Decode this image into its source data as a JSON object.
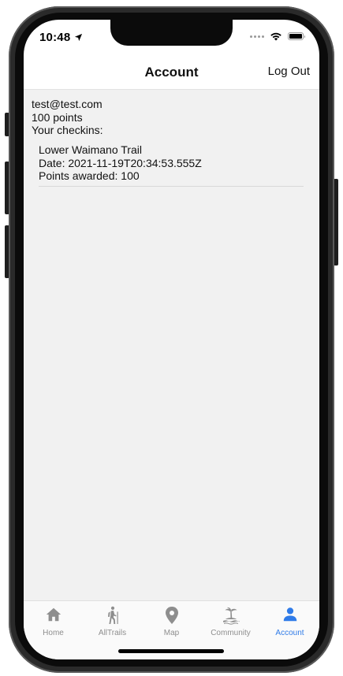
{
  "status_bar": {
    "time": "10:48"
  },
  "header": {
    "title": "Account",
    "logout_label": "Log Out"
  },
  "account": {
    "email": "test@test.com",
    "points": "100 points",
    "checkins_heading": "Your checkins:"
  },
  "checkins": [
    {
      "trail": "Lower Waimano Trail",
      "date": "Date: 2021-11-19T20:34:53.555Z",
      "points": "Points awarded: 100"
    }
  ],
  "tabs": [
    {
      "label": "Home",
      "icon": "home-icon"
    },
    {
      "label": "AllTrails",
      "icon": "hiker-icon"
    },
    {
      "label": "Map",
      "icon": "map-pin-icon"
    },
    {
      "label": "Community",
      "icon": "island-icon"
    },
    {
      "label": "Account",
      "icon": "person-icon"
    }
  ],
  "colors": {
    "active_tab": "#2f7be8",
    "inactive_tab": "#8e8e8e",
    "content_bg": "#f1f1f1"
  }
}
